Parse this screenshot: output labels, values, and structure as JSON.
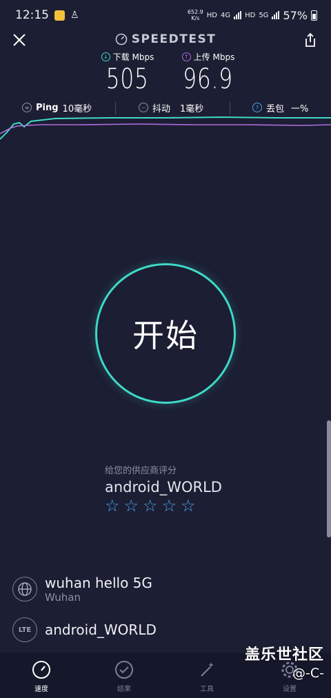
{
  "status_bar": {
    "time": "12:15",
    "net_speed_value": "652.9",
    "net_speed_unit": "K/s",
    "hd1": "HD",
    "net_type": "4G",
    "hd2": "HD",
    "net_type2": "5G",
    "battery": "57%"
  },
  "header": {
    "brand": "SPEEDTEST"
  },
  "metrics": {
    "download_label": "下载 Mbps",
    "download_value": "505",
    "upload_label": "上传 Mbps",
    "upload_value": "96.9"
  },
  "stats": {
    "ping_label": "Ping",
    "ping_value": "10毫秒",
    "jitter_label": "抖动",
    "jitter_value": "1毫秒",
    "loss_label": "丢包",
    "loss_value": "一%"
  },
  "start": {
    "label": "开始"
  },
  "rating": {
    "prompt": "给您的供应商评分",
    "provider": "android_WORLD",
    "stars_total": 5,
    "stars_filled": 0
  },
  "server": {
    "name": "wuhan hello 5G",
    "city": "Wuhan"
  },
  "carrier": {
    "badge": "LTE",
    "name": "android_WORLD"
  },
  "tabs": [
    {
      "label": "速度",
      "icon": "speedometer-icon",
      "active": true
    },
    {
      "label": "结果",
      "icon": "check-circle-icon",
      "active": false
    },
    {
      "label": "工具",
      "icon": "magic-wand-icon",
      "active": false
    },
    {
      "label": "设置",
      "icon": "gear-icon",
      "active": false
    }
  ],
  "watermark": {
    "line1": "盖乐世社区",
    "line2": "@-C-"
  },
  "colors": {
    "background": "#1c1e33",
    "download": "#3fd9c8",
    "upload": "#b06de0",
    "accent_blue": "#4aa3e6"
  }
}
